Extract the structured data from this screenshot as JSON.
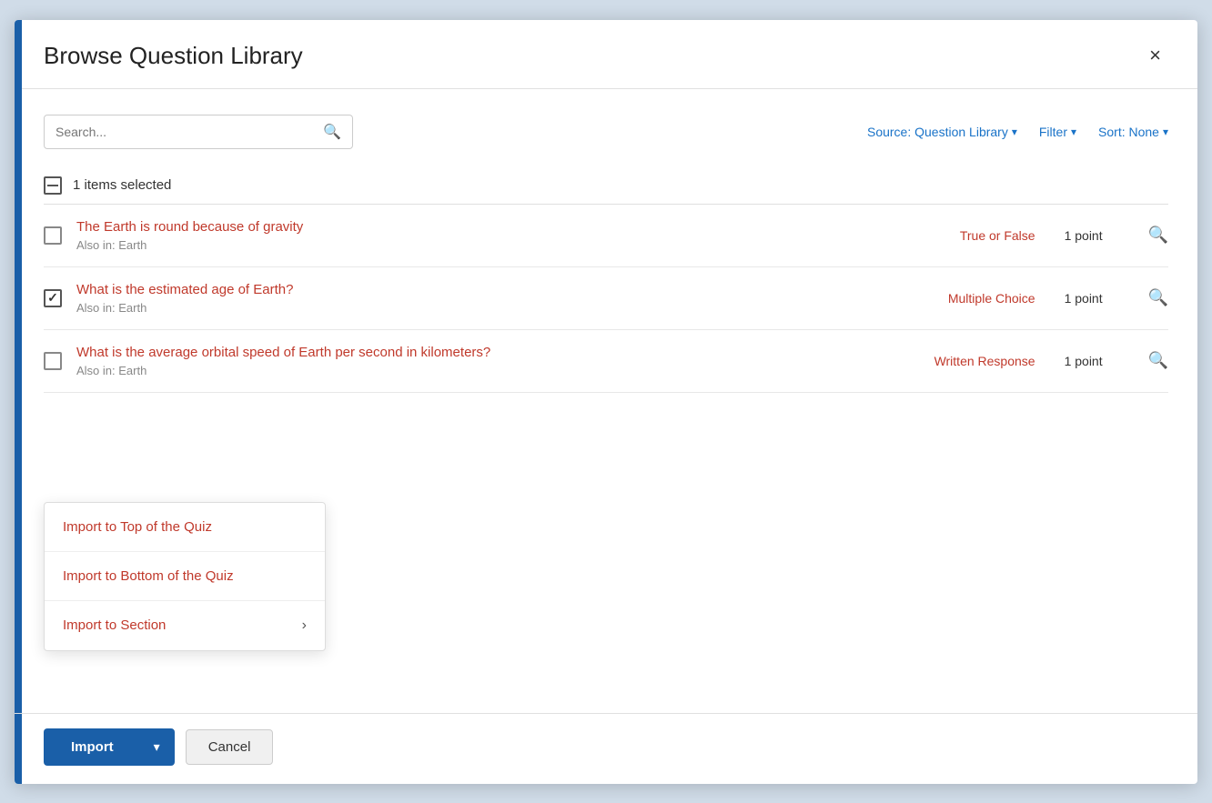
{
  "modal": {
    "title": "Browse Question Library",
    "close_label": "×"
  },
  "search": {
    "placeholder": "Search..."
  },
  "toolbar": {
    "source_label": "Source: Question Library",
    "filter_label": "Filter",
    "sort_label": "Sort: None"
  },
  "selection": {
    "count_text": "1 items selected"
  },
  "questions": [
    {
      "id": 1,
      "title": "The Earth is round because of gravity",
      "subtitle": "Also in: Earth",
      "type": "True or False",
      "points": "1 point",
      "checked": false
    },
    {
      "id": 2,
      "title": "What is the estimated age of Earth?",
      "subtitle": "Also in: Earth",
      "type": "Multiple Choice",
      "points": "1 point",
      "checked": true
    },
    {
      "id": 3,
      "title": "What is the average orbital speed of Earth per second in kilometers?",
      "subtitle": "Also in: Earth",
      "type": "Written Response",
      "points": "1 point",
      "checked": false
    }
  ],
  "footer": {
    "import_label": "Import",
    "cancel_label": "Cancel"
  },
  "dropdown_menu": {
    "items": [
      {
        "label": "Import to Top of the Quiz",
        "has_arrow": false
      },
      {
        "label": "Import to Bottom of the Quiz",
        "has_arrow": false
      },
      {
        "label": "Import to Section",
        "has_arrow": true
      }
    ]
  }
}
